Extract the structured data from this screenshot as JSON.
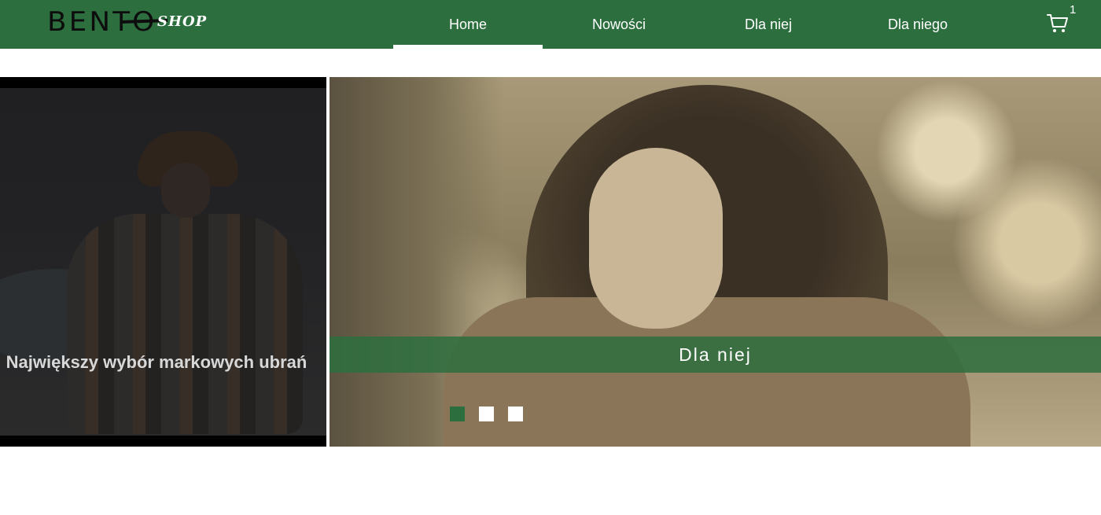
{
  "header": {
    "logo_main": "BENTO",
    "logo_sub": "SHOP",
    "nav": [
      {
        "label": "Home",
        "active": true
      },
      {
        "label": "Nowości"
      },
      {
        "label": "Dla niej"
      },
      {
        "label": "Dla niego"
      }
    ],
    "cart_count": "1",
    "cart_icon": "cart-icon"
  },
  "promo": {
    "text": "Największy wybór markowych ubrań"
  },
  "slider": {
    "caption": "Dla niej",
    "slides_count": 3,
    "active_slide": 1
  },
  "colors": {
    "brand_green": "#2d6e3e",
    "white": "#ffffff"
  }
}
